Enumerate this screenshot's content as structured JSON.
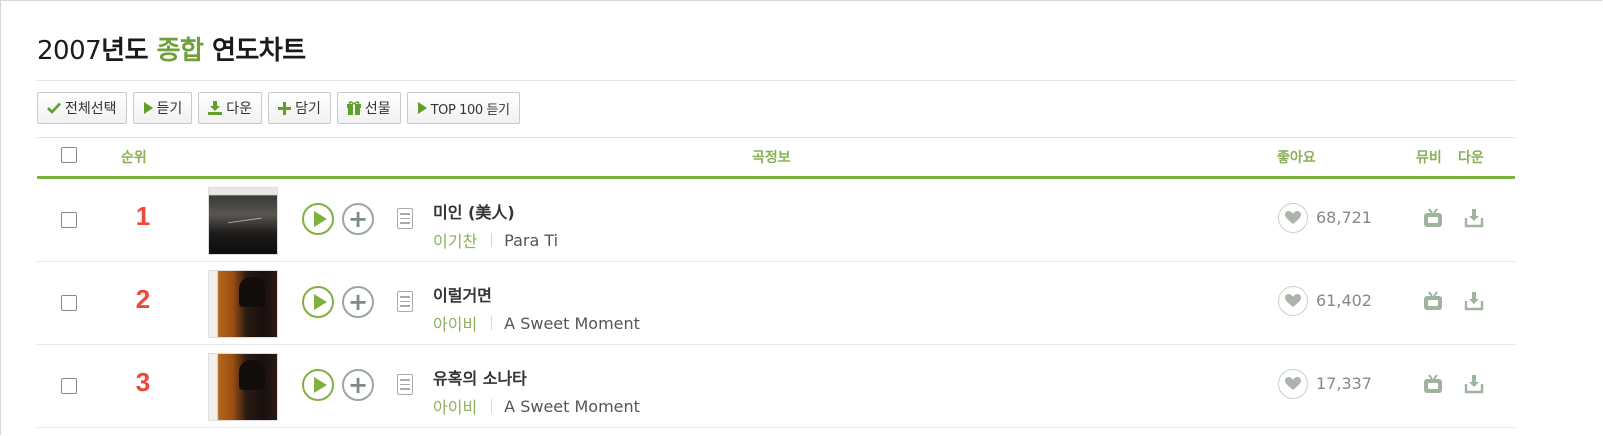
{
  "title": {
    "year": "2007",
    "year_suffix": "년도 ",
    "accent": "종합",
    "rest": " 연도차트"
  },
  "toolbar": [
    {
      "label": "전체선택",
      "icon": "check-icon"
    },
    {
      "label": "듣기",
      "icon": "play-icon"
    },
    {
      "label": "다운",
      "icon": "download-icon"
    },
    {
      "label": "담기",
      "icon": "plus-icon"
    },
    {
      "label": "선물",
      "icon": "gift-icon"
    },
    {
      "label": "TOP 100 듣기",
      "icon": "play-icon"
    }
  ],
  "table": {
    "headers": {
      "rank": "순위",
      "info": "곡정보",
      "likes": "좋아요",
      "mv": "뮤비",
      "download": "다운"
    },
    "rows": [
      {
        "rank": "1",
        "title": "미인 (美人)",
        "artist": "이기찬",
        "album": "Para Ti",
        "likes": "68,721"
      },
      {
        "rank": "2",
        "title": "이럴거면",
        "artist": "아이비",
        "album": "A Sweet Moment",
        "likes": "61,402"
      },
      {
        "rank": "3",
        "title": "유혹의 소나타",
        "artist": "아이비",
        "album": "A Sweet Moment",
        "likes": "17,337"
      }
    ]
  },
  "colors": {
    "accent_green": "#6fa13a",
    "header_green": "#8bb05a",
    "rank_red": "#f0473c",
    "rule_green": "#7ab23b"
  }
}
